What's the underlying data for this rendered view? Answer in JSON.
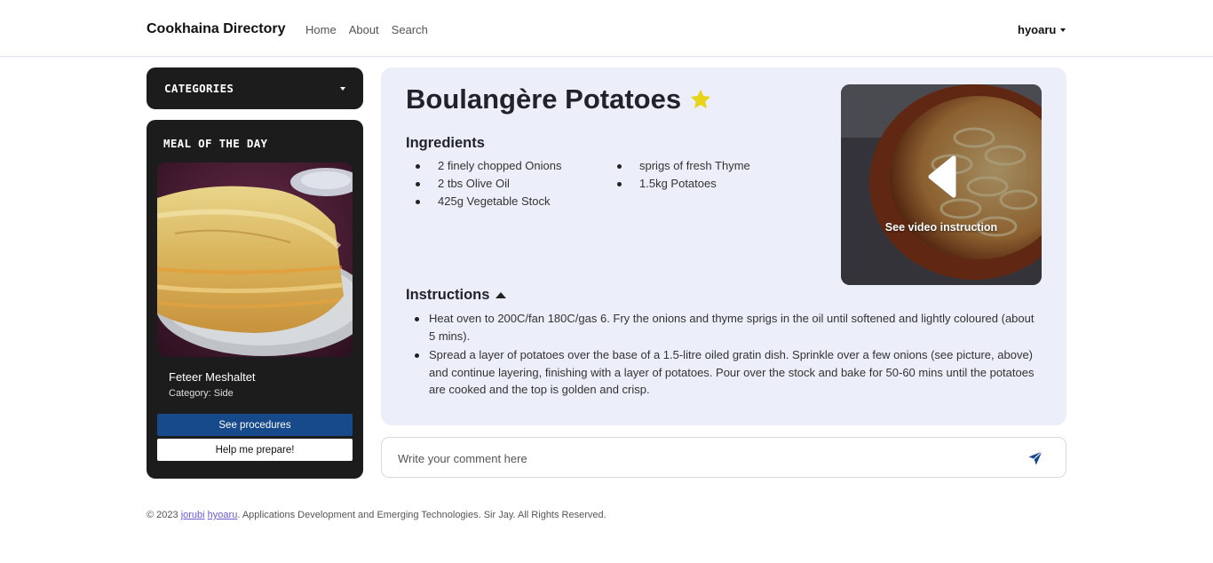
{
  "navbar": {
    "brand": "Cookhaina Directory",
    "links": [
      "Home",
      "About",
      "Search"
    ],
    "user": "hyoaru"
  },
  "sidebar": {
    "categories_label": "CATEGORIES",
    "meal_of_day": {
      "title": "MEAL OF THE DAY",
      "name": "Feteer Meshaltet",
      "category": "Category: Side",
      "procedures_button": "See procedures",
      "help_button": "Help me prepare!"
    }
  },
  "recipe": {
    "title": "Boulangère Potatoes",
    "ingredients_title": "Ingredients",
    "ingredients_col1": [
      "2 finely chopped Onions",
      "2 tbs Olive Oil",
      "425g Vegetable Stock"
    ],
    "ingredients_col2": [
      "sprigs of fresh Thyme",
      "1.5kg Potatoes"
    ],
    "instructions_title": "Instructions",
    "instructions": [
      "Heat oven to 200C/fan 180C/gas 6. Fry the onions and thyme sprigs in the oil until softened and lightly coloured (about 5 mins).",
      "Spread a layer of potatoes over the base of a 1.5-litre oiled gratin dish. Sprinkle over a few onions (see picture, above) and continue layering, finishing with a layer of potatoes. Pour over the stock and bake for 50-60 mins until the potatoes are cooked and the top is golden and crisp."
    ],
    "video_label": "See video instruction",
    "favorite_color": "#e8d21a"
  },
  "comment": {
    "placeholder": "Write your comment here"
  },
  "footer": {
    "prefix": "© 2023 ",
    "author1": "jorubi",
    "author2": "hyoaru",
    "suffix": ". Applications Development and Emerging Technologies. Sir Jay. All Rights Reserved."
  },
  "colors": {
    "dark_panel": "#1c1c1c",
    "primary_button": "#164a8a",
    "recipe_bg": "#eceff9",
    "send_icon": "#164a8a"
  }
}
